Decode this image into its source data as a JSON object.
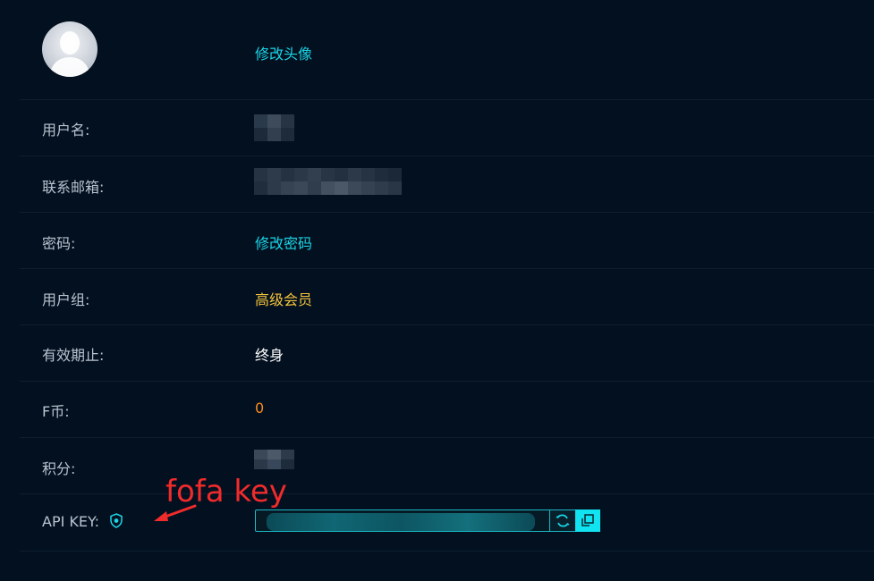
{
  "profile": {
    "change_avatar_label": "修改头像"
  },
  "fields": {
    "username": {
      "label": "用户名:"
    },
    "email": {
      "label": "联系邮箱:"
    },
    "password": {
      "label": "密码:",
      "action_label": "修改密码"
    },
    "user_group": {
      "label": "用户组:",
      "value": "高级会员"
    },
    "valid_until": {
      "label": "有效期止:",
      "value": "终身"
    },
    "f_coin": {
      "label": "F币:",
      "value": "0"
    },
    "points": {
      "label": "积分:"
    },
    "api_key": {
      "label": "API KEY:"
    }
  },
  "annotation": {
    "text": "fofa key",
    "color": "#f02b2b"
  },
  "icons": {
    "api_key_info": "shield-icon",
    "refresh": "refresh-icon",
    "copy": "copy-icon"
  },
  "colors": {
    "background": "#031020",
    "link": "#19d6e6",
    "gold": "#f3c23a",
    "orange": "#ff8c1a",
    "divider": "#0e1f2f",
    "label": "#b9c3cf"
  }
}
